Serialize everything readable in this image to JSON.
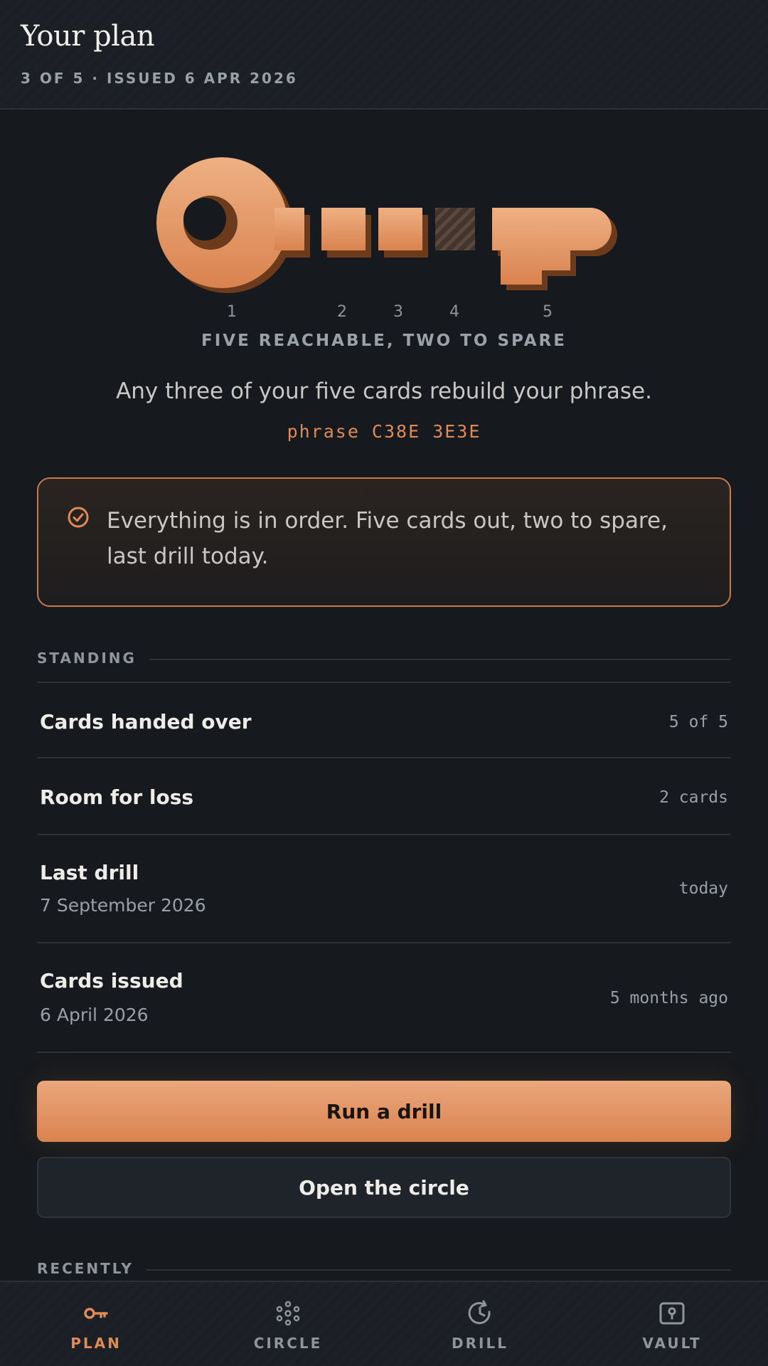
{
  "header": {
    "title": "Your plan",
    "subtitle": "3 OF 5 · ISSUED 6 APR 2026"
  },
  "key": {
    "numbers": [
      "1",
      "2",
      "3",
      "4",
      "5"
    ],
    "missing_card": "4",
    "caption": "FIVE REACHABLE, TWO TO SPARE"
  },
  "summary": {
    "threshold_text": "Any three of your five cards rebuild your phrase.",
    "phrase_id": "phrase C38E 3E3E"
  },
  "status": {
    "icon": "check-circle-icon",
    "message": "Everything is in order. Five cards out, two to spare, last drill today."
  },
  "standing": {
    "label": "STANDING",
    "rows": [
      {
        "name": "Cards handed over",
        "sub": "",
        "value": "5 of 5"
      },
      {
        "name": "Room for loss",
        "sub": "",
        "value": "2 cards"
      },
      {
        "name": "Last drill",
        "sub": "7 September 2026",
        "value": "today"
      },
      {
        "name": "Cards issued",
        "sub": "6 April 2026",
        "value": "5 months ago"
      }
    ]
  },
  "actions": {
    "primary": "Run a drill",
    "secondary": "Open the circle"
  },
  "recently": {
    "label": "RECENTLY"
  },
  "nav": {
    "items": [
      {
        "label": "PLAN",
        "icon": "key-icon",
        "active": true
      },
      {
        "label": "CIRCLE",
        "icon": "circle-nodes-icon",
        "active": false
      },
      {
        "label": "DRILL",
        "icon": "clock-refresh-icon",
        "active": false
      },
      {
        "label": "VAULT",
        "icon": "vault-lock-icon",
        "active": false
      }
    ]
  },
  "colors": {
    "accent": "#e08a55",
    "background": "#16191d",
    "status_border": "#c87a4c"
  }
}
